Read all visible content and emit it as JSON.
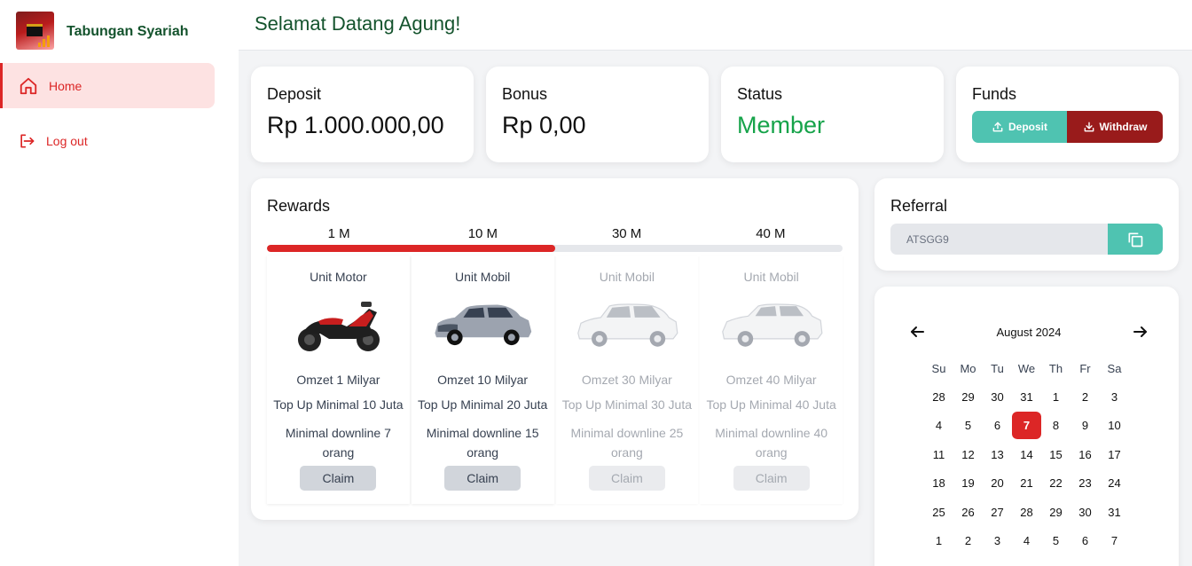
{
  "sidebar": {
    "brand": "Tabungan Syariah",
    "nav": [
      {
        "label": "Home",
        "icon": "home-icon",
        "active": true
      },
      {
        "label": "Log out",
        "icon": "logout-icon",
        "active": false
      }
    ]
  },
  "header": {
    "welcome": "Selamat Datang Agung!"
  },
  "stats": {
    "deposit": {
      "title": "Deposit",
      "value": "Rp 1.000.000,00"
    },
    "bonus": {
      "title": "Bonus",
      "value": "Rp 0,00"
    },
    "status": {
      "title": "Status",
      "value": "Member"
    },
    "funds": {
      "title": "Funds",
      "deposit_label": "Deposit",
      "withdraw_label": "Withdraw"
    }
  },
  "rewards": {
    "title": "Rewards",
    "tiers": [
      "1 M",
      "10 M",
      "30 M",
      "40 M"
    ],
    "progress_fraction": 0.5,
    "units": [
      {
        "title": "Unit Motor",
        "omzet": "Omzet 1 Milyar",
        "topup": "Top Up Minimal 10 Juta",
        "downline": "Minimal downline 7 orang",
        "claim": "Claim",
        "locked": false,
        "image": "motorbike"
      },
      {
        "title": "Unit Mobil",
        "omzet": "Omzet 10 Milyar",
        "topup": "Top Up Minimal 20 Juta",
        "downline": "Minimal downline 15 orang",
        "claim": "Claim",
        "locked": false,
        "image": "mpv-car"
      },
      {
        "title": "Unit Mobil",
        "omzet": "Omzet 30 Milyar",
        "topup": "Top Up Minimal 30 Juta",
        "downline": "Minimal downline 25 orang",
        "claim": "Claim",
        "locked": true,
        "image": "mpv-car-white"
      },
      {
        "title": "Unit Mobil",
        "omzet": "Omzet 40 Milyar",
        "topup": "Top Up Minimal 40 Juta",
        "downline": "Minimal downline 40 orang",
        "claim": "Claim",
        "locked": true,
        "image": "suv-car-white"
      }
    ]
  },
  "referral": {
    "title": "Referral",
    "code": "ATSGG9",
    "copy_icon": "copy-icon"
  },
  "calendar": {
    "month": "August 2024",
    "weekdays": [
      "Su",
      "Mo",
      "Tu",
      "We",
      "Th",
      "Fr",
      "Sa"
    ],
    "days": [
      [
        "28",
        "29",
        "30",
        "31",
        "1",
        "2",
        "3"
      ],
      [
        "4",
        "5",
        "6",
        "7",
        "8",
        "9",
        "10"
      ],
      [
        "11",
        "12",
        "13",
        "14",
        "15",
        "16",
        "17"
      ],
      [
        "18",
        "19",
        "20",
        "21",
        "22",
        "23",
        "24"
      ],
      [
        "25",
        "26",
        "27",
        "28",
        "29",
        "30",
        "31"
      ],
      [
        "1",
        "2",
        "3",
        "4",
        "5",
        "6",
        "7"
      ]
    ],
    "selected": "7"
  },
  "colors": {
    "brand_green": "#14532d",
    "accent_red": "#dc2626",
    "teal": "#4fc3b1",
    "dark_red": "#991b1b"
  }
}
